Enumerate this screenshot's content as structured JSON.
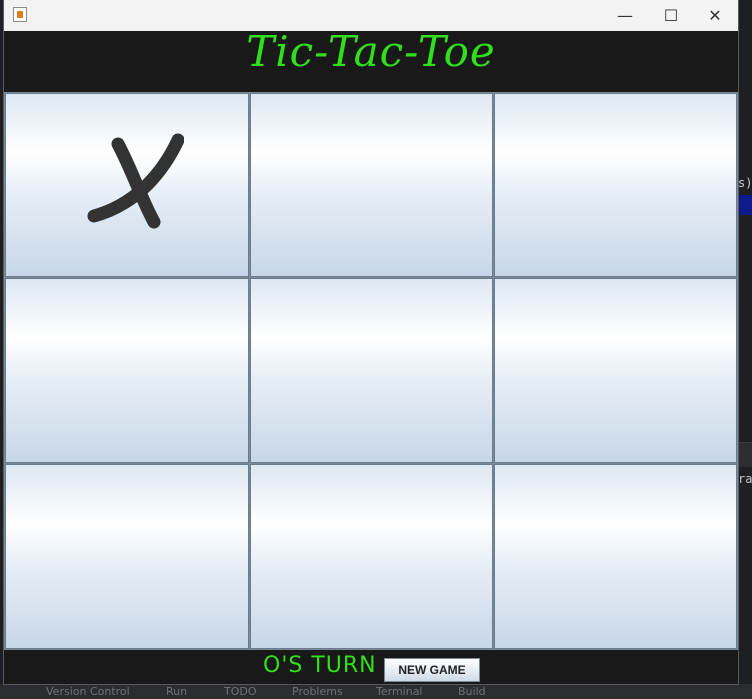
{
  "window": {
    "icon": "java-app-icon",
    "controls": {
      "minimize": "—",
      "maximize": "☐",
      "close": "✕"
    }
  },
  "game": {
    "title": "Tic-Tac-Toe",
    "turn_text": "O'S TURN",
    "new_game_label": "NEW GAME",
    "board": [
      "X",
      "",
      "",
      "",
      "",
      "",
      "",
      "",
      ""
    ]
  },
  "colors": {
    "title_green": "#2fe01a",
    "header_bg": "#191919",
    "mark": "#333333"
  },
  "background_ide": {
    "snippet_a": "s)",
    "snippet_b": "ra",
    "statusbar": [
      "Version Control",
      "Run",
      "TODO",
      "Problems",
      "Terminal",
      "Build"
    ]
  }
}
